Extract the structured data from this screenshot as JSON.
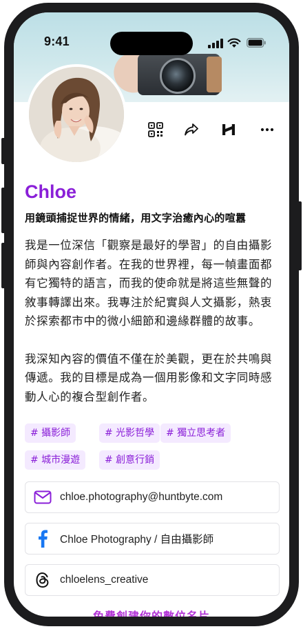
{
  "status_bar": {
    "time": "9:41"
  },
  "profile": {
    "name": "Chloe",
    "tagline": "用鏡頭捕捉世界的情緒，用文字治癒內心的喧囂",
    "bio_paragraph_1": "我是一位深信「觀察是最好的學習」的自由攝影師與內容創作者。在我的世界裡，每一幀畫面都有它獨特的語言，而我的使命就是將這些無聲的敘事轉譯出來。我專注於紀實與人文攝影，熱衷於探索都市中的微小細節和邊緣群體的故事。",
    "bio_paragraph_2": "我深知內容的價值不僅在於美觀，更在於共鳴與傳遞。我的目標是成為一個用影像和文字同時感動人心的複合型創作者。"
  },
  "actions": {
    "icons": [
      "qr-code-icon",
      "share-icon",
      "brand-logo-icon",
      "more-icon"
    ]
  },
  "tags": [
    "# 攝影師",
    "# 光影哲學",
    "# 獨立思考者",
    "# 城市漫遊",
    "# 創意行銷"
  ],
  "contacts": [
    {
      "icon": "email-icon",
      "label": "chloe.photography@huntbyte.com"
    },
    {
      "icon": "facebook-icon",
      "label": "Chloe Photography / 自由攝影師"
    },
    {
      "icon": "threads-icon",
      "label": "chloelens_creative"
    }
  ],
  "footer": {
    "link_text": "免費創建你的數位名片"
  },
  "colors": {
    "accent": "#8a1fd8",
    "tag_bg": "#f4eaff",
    "frame": "#1c1c1e",
    "footer_link": "#b233d6"
  }
}
